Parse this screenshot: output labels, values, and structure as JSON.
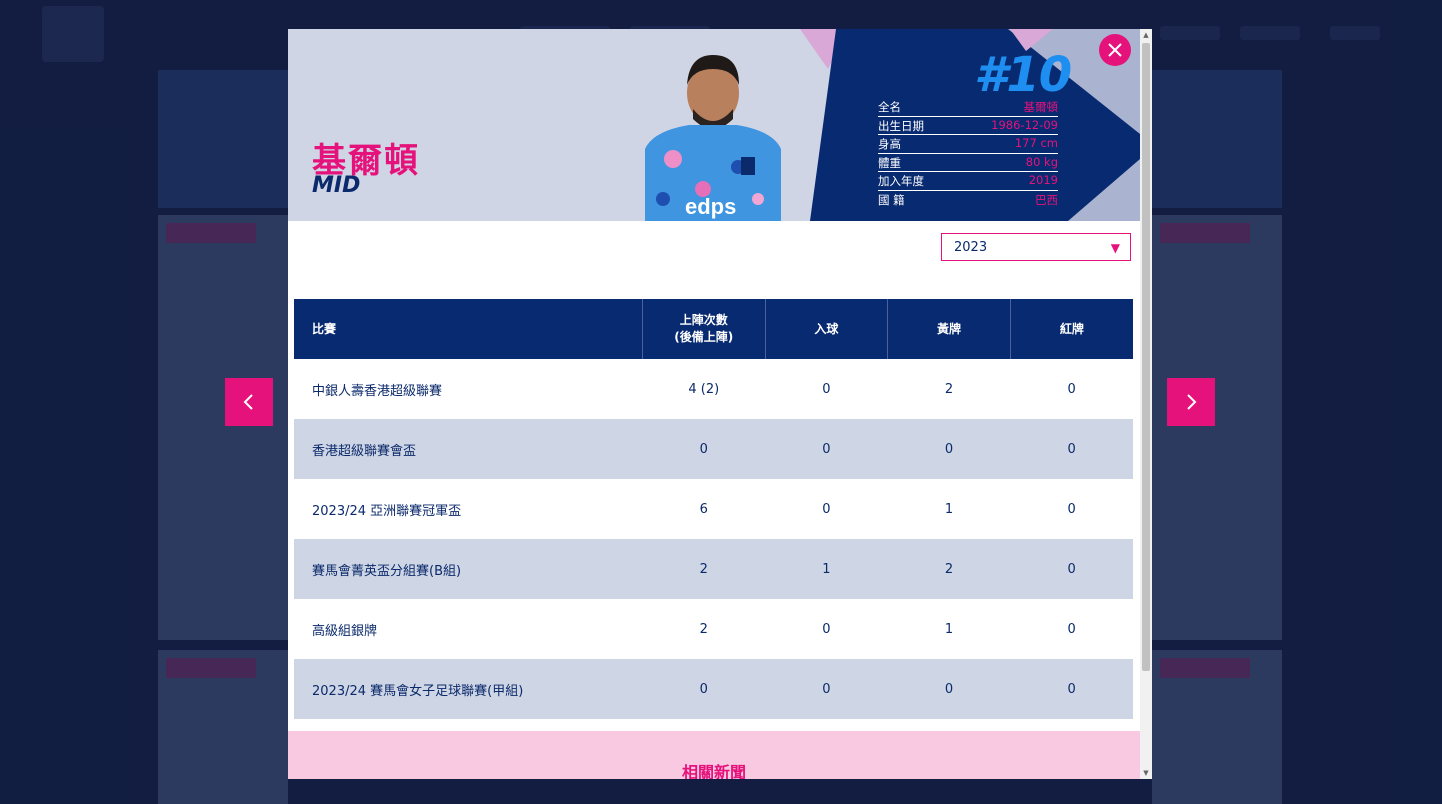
{
  "player": {
    "name": "基爾頓",
    "position": "MID",
    "number": "#10",
    "info": [
      {
        "label": "全名",
        "value": "基爾頓"
      },
      {
        "label": "出生日期",
        "value": "1986-12-09"
      },
      {
        "label": "身高",
        "value": "177 cm"
      },
      {
        "label": "體重",
        "value": "80 kg"
      },
      {
        "label": "加入年度",
        "value": "2019"
      },
      {
        "label": "國 籍",
        "value": "巴西"
      }
    ],
    "shirt_text": "edps"
  },
  "season": {
    "selected": "2023"
  },
  "stats": {
    "headers": {
      "competition": "比賽",
      "apps_line1": "上陣次數",
      "apps_line2": "(後備上陣)",
      "goals": "入球",
      "yellow": "黃牌",
      "red": "紅牌"
    },
    "rows": [
      {
        "competition": "中銀人壽香港超級聯賽",
        "apps": "4 (2)",
        "goals": "0",
        "yellow": "2",
        "red": "0"
      },
      {
        "competition": "香港超級聯賽會盃",
        "apps": "0",
        "goals": "0",
        "yellow": "0",
        "red": "0"
      },
      {
        "competition": "2023/24 亞洲聯賽冠軍盃",
        "apps": "6",
        "goals": "0",
        "yellow": "1",
        "red": "0"
      },
      {
        "competition": "賽馬會菁英盃分組賽(B組)",
        "apps": "2",
        "goals": "1",
        "yellow": "2",
        "red": "0"
      },
      {
        "competition": "高級組銀牌",
        "apps": "2",
        "goals": "0",
        "yellow": "1",
        "red": "0"
      },
      {
        "competition": "2023/24 賽馬會女子足球聯賽(甲組)",
        "apps": "0",
        "goals": "0",
        "yellow": "0",
        "red": "0"
      }
    ]
  },
  "news": {
    "title": "相關新聞"
  },
  "icons": {
    "close": "close-icon",
    "prev": "chevron-left-icon",
    "next": "chevron-right-icon",
    "dropdown": "caret-down-icon"
  },
  "colors": {
    "accent": "#e6127b",
    "navy": "#082a71",
    "hero_bg": "#cfd5e4",
    "row_alt": "#ced5e4",
    "number_blue": "#1e8ef0"
  }
}
